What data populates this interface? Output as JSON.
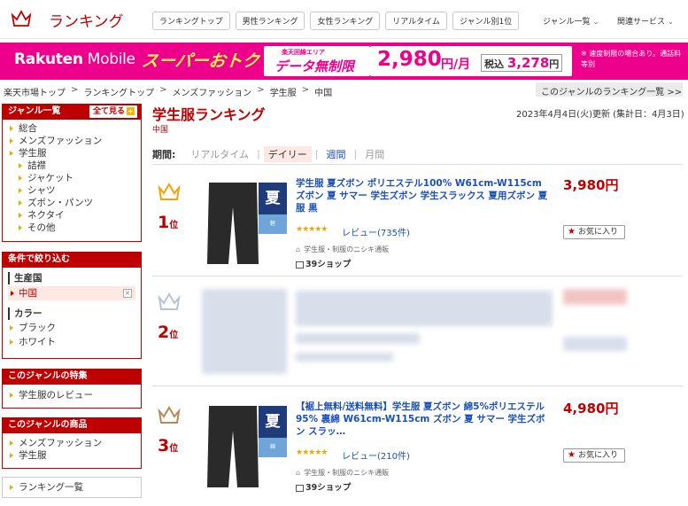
{
  "header": {
    "logo_text": "ランキング",
    "nav_pills": [
      "ランキングトップ",
      "男性ランキング",
      "女性ランキング",
      "リアルタイム",
      "ジャンル別1位"
    ],
    "genre_list": "ジャンル一覧",
    "related": "関連サービス"
  },
  "banner": {
    "brand_bold": "Rakuten",
    "brand_thin": " Mobile",
    "super": "スーパーおトク",
    "area_note": "楽天回線エリア",
    "data_unlimited": "データ無制限",
    "price": "2,980",
    "unit": "円/月",
    "tax_label": "税込",
    "tax_price": "3,278",
    "tax_unit": "円",
    "note": "※ 速度制限の場合あり。通話料等別"
  },
  "breadcrumb": [
    "楽天市場トップ",
    "ランキングトップ",
    "メンズファッション",
    "学生服",
    "中国"
  ],
  "genre_list_link": "このジャンルのランキング一覧 >>",
  "sidebar": {
    "genre_box": {
      "title": "ジャンル一覧",
      "see_all": "全て見る",
      "items": [
        {
          "label": "総合",
          "level": 0
        },
        {
          "label": "メンズファッション",
          "level": 0
        },
        {
          "label": "学生服",
          "level": 0
        },
        {
          "label": "詰襟",
          "level": 1
        },
        {
          "label": "ジャケット",
          "level": 1
        },
        {
          "label": "シャツ",
          "level": 1
        },
        {
          "label": "ズボン・パンツ",
          "level": 1
        },
        {
          "label": "ネクタイ",
          "level": 1
        },
        {
          "label": "その他",
          "level": 1
        }
      ]
    },
    "filter_box": {
      "title": "条件で絞り込む",
      "origin_label": "生産国",
      "origin_selected": "中国",
      "color_label": "カラー",
      "colors": [
        "ブラック",
        "ホワイト"
      ]
    },
    "feature_box": {
      "title": "このジャンルの特集",
      "items": [
        "学生服のレビュー"
      ]
    },
    "product_box": {
      "title": "このジャンルの商品",
      "items": [
        "メンズファッション",
        "学生服"
      ]
    },
    "ranking_list": "ランキング一覧"
  },
  "main": {
    "title": "学生服ランキング",
    "subtitle": "中国",
    "updated": "2023年4月4日(火)更新 (集計日：4月3日)",
    "period_label": "期間:",
    "periods": [
      "リアルタイム",
      "デイリー",
      "週間",
      "月間"
    ]
  },
  "items": [
    {
      "rank": "1",
      "rank_suffix": "位",
      "title": "学生服 夏ズボン ポリエステル100% W61cm-W115cm ズボン 夏 サマー 学生ズボン 学生スラックス 夏用ズボン 夏服 黒",
      "price": "3,980円",
      "stars": "★★★★★",
      "review": "レビュー(735件)",
      "shop": "学生服・制服のニシキ通販",
      "shop_count": "39ショップ",
      "fav": "お気に入り",
      "tag": "夏",
      "tag_sub": "軽"
    },
    {
      "rank": "2",
      "rank_suffix": "位"
    },
    {
      "rank": "3",
      "rank_suffix": "位",
      "title": "【裾上無料/送料無料】学生服 夏ズボン 綿5%ポリエステル95% 裏綿 W61cm-W115cm ズボン 夏 サマー 学生ズボン スラッ…",
      "price": "4,980円",
      "stars": "★★★★★",
      "review": "レビュー(210件)",
      "shop": "学生服・制服のニシキ通販",
      "shop_count": "39ショップ",
      "fav": "お気に入り",
      "tag": "夏",
      "tag_sub": "綿"
    }
  ],
  "colors": {
    "accent": "#bf0000",
    "banner": "#ec008c",
    "link": "#1a50b8",
    "gold": "#f0a500"
  }
}
